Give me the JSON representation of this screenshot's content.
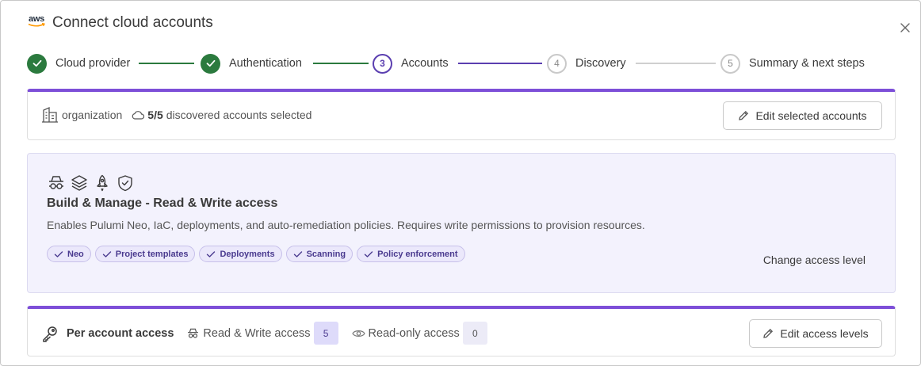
{
  "header": {
    "logo_text": "aws",
    "title": "Connect cloud accounts"
  },
  "stepper": {
    "steps": [
      {
        "number": "1",
        "label": "Cloud provider",
        "state": "done"
      },
      {
        "number": "2",
        "label": "Authentication",
        "state": "done"
      },
      {
        "number": "3",
        "label": "Accounts",
        "state": "active"
      },
      {
        "number": "4",
        "label": "Discovery",
        "state": "todo"
      },
      {
        "number": "5",
        "label": "Summary & next steps",
        "state": "todo"
      }
    ]
  },
  "accounts_card": {
    "org_label": "organization",
    "selected_count": "5/5",
    "selected_text": "discovered accounts selected",
    "edit_button": "Edit selected accounts"
  },
  "access_card": {
    "icons": [
      "spy-icon",
      "layers-icon",
      "rocket-icon",
      "shield-check-icon"
    ],
    "title": "Build & Manage - Read & Write access",
    "description": "Enables Pulumi Neo, IaC, deployments, and auto-remediation policies. Requires write permissions to provision resources.",
    "features": [
      "Neo",
      "Project templates",
      "Deployments",
      "Scanning",
      "Policy enforcement"
    ],
    "change_link": "Change access level"
  },
  "per_account_card": {
    "title": "Per account access",
    "read_write_label": "Read & Write access",
    "read_write_count": "5",
    "read_only_label": "Read-only access",
    "read_only_count": "0",
    "edit_button": "Edit access levels"
  },
  "colors": {
    "accent_purple": "#7d4fd8",
    "done_green": "#2b7a3e",
    "active_purple": "#5b3fb0"
  }
}
